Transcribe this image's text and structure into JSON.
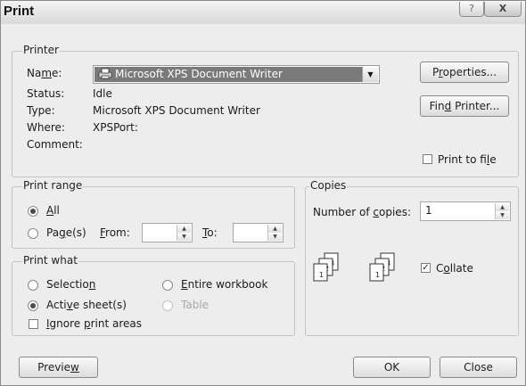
{
  "window": {
    "title": "Print"
  },
  "printer": {
    "group_label": "Printer",
    "name_label_a": "Na",
    "name_label_u": "m",
    "name_label_b": "e:",
    "name_value": "Microsoft XPS Document Writer",
    "status_label": "Status:",
    "status_value": "Idle",
    "type_label": "Type:",
    "type_value": "Microsoft XPS Document Writer",
    "where_label": "Where:",
    "where_value": "XPSPort:",
    "comment_label": "Comment:",
    "comment_value": "",
    "properties_a": "P",
    "properties_u": "r",
    "properties_b": "operties...",
    "find_a": "Fin",
    "find_u": "d",
    "find_b": " Printer...",
    "print_to_file_a": "Print to fi",
    "print_to_file_u": "l",
    "print_to_file_b": "e",
    "print_to_file_checked": false
  },
  "print_range": {
    "group_label": "Print range",
    "all_u": "A",
    "all_b": "ll",
    "pages_a": "Pa",
    "pages_u": "g",
    "pages_b": "e(s)",
    "from_u": "F",
    "from_b": "rom:",
    "to_u": "T",
    "to_b": "o:",
    "from_value": "",
    "to_value": "",
    "selected": "all"
  },
  "print_what": {
    "group_label": "Print what",
    "selection_a": "Selectio",
    "selection_u": "n",
    "entire_u": "E",
    "entire_b": "ntire workbook",
    "active_a": "Acti",
    "active_u": "v",
    "active_b": "e sheet(s)",
    "table_label": "Table",
    "ignore_u": "I",
    "ignore_b": "gnore ",
    "ignore_u2": "p",
    "ignore_c": "rint areas",
    "selected": "active_sheets",
    "ignore_checked": false
  },
  "copies": {
    "group_label": "Copies",
    "number_a": "Number of ",
    "number_u": "c",
    "number_b": "opies:",
    "value": "1",
    "collate_a": "C",
    "collate_u": "o",
    "collate_b": "llate",
    "collate_checked": true
  },
  "footer": {
    "preview_a": "Previe",
    "preview_u": "w",
    "ok": "OK",
    "close": "Close"
  },
  "icons": {
    "checkmark": "✓",
    "dropdown": "▼",
    "spin_up": "▲",
    "spin_down": "▼",
    "help": "?",
    "close": "X"
  }
}
